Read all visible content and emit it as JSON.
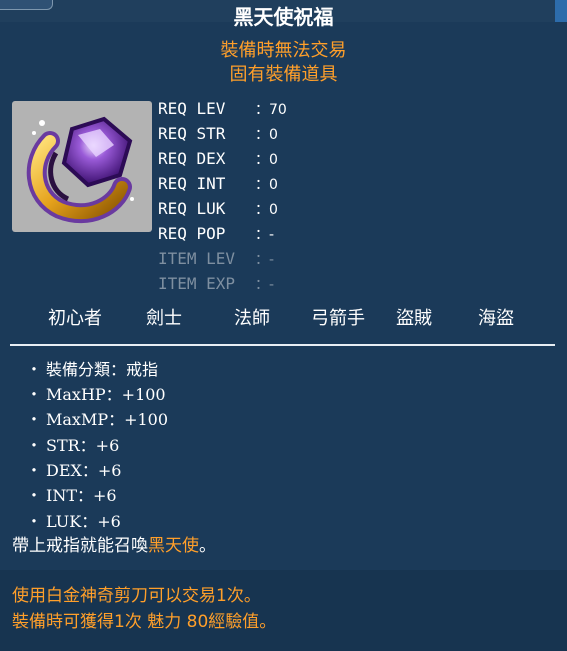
{
  "item": {
    "name": "黑天使祝福",
    "tags": [
      "裝備時無法交易",
      "固有裝備道具"
    ],
    "requirements": [
      {
        "label": "REQ LEV",
        "value": "70"
      },
      {
        "label": "REQ STR",
        "value": "0"
      },
      {
        "label": "REQ DEX",
        "value": "0"
      },
      {
        "label": "REQ INT",
        "value": "0"
      },
      {
        "label": "REQ LUK",
        "value": "0"
      },
      {
        "label": "REQ POP",
        "value": "-"
      },
      {
        "label": "ITEM LEV",
        "value": "-"
      },
      {
        "label": "ITEM EXP",
        "value": "-"
      }
    ],
    "separator": "：",
    "jobs": [
      "初心者",
      "劍士",
      "法師",
      "弓箭手",
      "盜賊",
      "海盜"
    ],
    "bullet": "・",
    "stats": [
      "裝備分類：戒指",
      "MaxHP：+100",
      "MaxMP：+100",
      "STR：+6",
      "DEX：+6",
      "INT：+6",
      "LUK：+6"
    ],
    "description": {
      "prefix": "帶上戒指就能召喚",
      "highlight": "黑天使",
      "suffix": "。"
    },
    "footer": [
      "使用白金神奇剪刀可以交易1次。",
      "裝備時可獲得1次 魅力 80經驗值。"
    ]
  },
  "colors": {
    "background": "#1b3a59",
    "orange": "#ff9f2a",
    "dim": "#7e8fa0",
    "icon_bg": "#b3b3b3"
  },
  "icon": "purple-gem-gold-ring-icon"
}
